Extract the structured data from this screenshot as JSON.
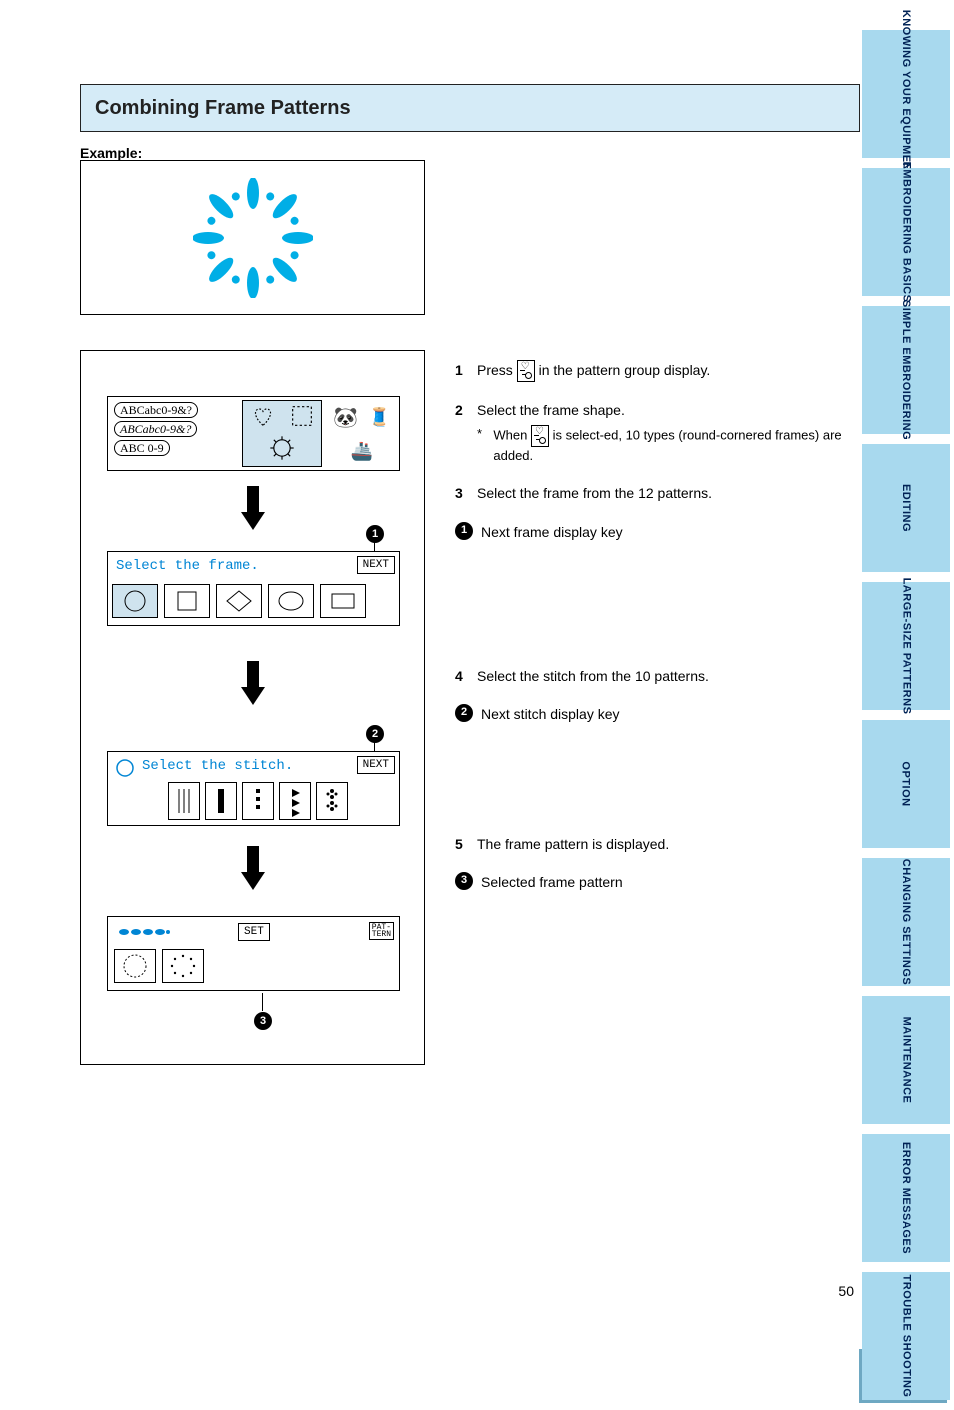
{
  "title": "Combining Frame Patterns",
  "example_label": "Example:",
  "screens": {
    "s2_prompt": "Select the frame.",
    "s3_prompt": "Select the stitch.",
    "next_label": "NEXT",
    "set_label": "SET",
    "pattern_label": "PAT-\nTERN",
    "font1": "ABCabc0-9&?",
    "font2": "ABCabc0-9&?",
    "font3": "ABC 0-9"
  },
  "steps": {
    "s1": {
      "num": "1",
      "text_a": "Press",
      "text_b": "in the pattern group display."
    },
    "s2": {
      "num": "2",
      "text_a": "Select the frame shape.",
      "asterisk": "When",
      "asterisk2": "is select-ed, 10 types (round-cornered frames) are added."
    },
    "s3": {
      "num": "3",
      "text_a": "Select the frame from the 12 patterns.",
      "note1": "Next frame display key"
    },
    "s4": {
      "num": "4",
      "text_a": "Select the stitch from the 10 patterns.",
      "note2": "Next stitch display key"
    },
    "s5": {
      "num": "5",
      "text_a": "The frame pattern is displayed.",
      "note3": "Selected frame pattern"
    }
  },
  "tabs": [
    "KNOWING YOUR EQUIPMENT",
    "EMBROIDERING BASICS",
    "SIMPLE EMBROIDERING",
    "EDITING",
    "LARGE-SIZE PATTERNS",
    "OPTION",
    "CHANGING SETTINGS",
    "MAINTENANCE",
    "ERROR MESSAGES",
    "TROUBLE SHOOTING"
  ],
  "markers": {
    "m1": "1",
    "m2": "2",
    "m3": "3"
  },
  "page_number": "50"
}
